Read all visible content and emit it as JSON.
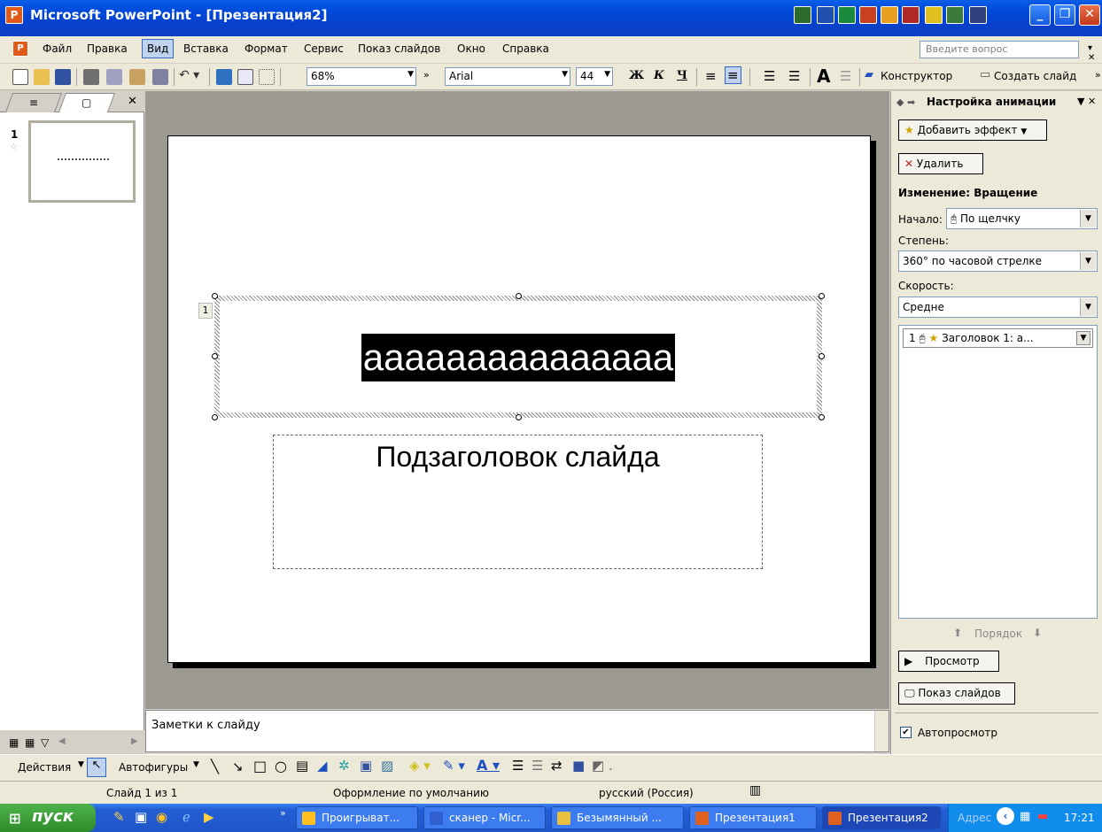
{
  "window": {
    "title": "Microsoft PowerPoint - [Презентация2]",
    "controls": {
      "minimize": "_",
      "restore": "❐",
      "close": "✕"
    }
  },
  "menu": {
    "items": [
      "Файл",
      "Правка",
      "Вид",
      "Вставка",
      "Формат",
      "Сервис",
      "Показ слайдов",
      "Окно",
      "Справка"
    ],
    "help_placeholder": "Введите вопрос"
  },
  "toolbar": {
    "zoom": "68%",
    "font": "Arial",
    "font_size": "44",
    "bold": "Ж",
    "italic": "К",
    "underline": "Ч",
    "designer": "Конструктор",
    "new_slide": "Создать слайд"
  },
  "left_pane": {
    "slide_number": "1",
    "tab_outline_icon": "outline-icon",
    "tab_slides_icon": "slides-icon"
  },
  "slide": {
    "title": "ааааааааааааааа",
    "subtitle": "Подзаголовок слайда",
    "anim_tag": "1"
  },
  "notes": {
    "placeholder": "Заметки к слайду"
  },
  "animation_pane": {
    "header": "Настройка анимации",
    "add_effect": "Добавить эффект",
    "remove": "Удалить",
    "change_label": "Изменение: Вращение",
    "start_label": "Начало:",
    "start_value": "По щелчку",
    "degree_label": "Степень:",
    "degree_value": "360° по часовой стрелке",
    "speed_label": "Скорость:",
    "speed_value": "Средне",
    "list_item_num": "1",
    "list_item": "Заголовок 1: а...",
    "order": "Порядок",
    "preview": "Просмотр",
    "slideshow": "Показ слайдов",
    "autopreview": "Автопросмотр",
    "autopreview_checked": true
  },
  "draw_toolbar": {
    "actions": "Действия",
    "autoshapes": "Автофигуры"
  },
  "status": {
    "slide": "Слайд 1 из 1",
    "design": "Оформление по умолчанию",
    "language": "русский (Россия)"
  },
  "taskbar": {
    "start": "пуск",
    "tasks": [
      "Проигрыват...",
      "сканер - Micr...",
      "Безымянный ...",
      "Презентация1",
      "Презентация2"
    ],
    "address": "Адрес",
    "clock": "17:21"
  },
  "colors": {
    "titlebar": "#0a5ee8",
    "taskbar": "#245fd6",
    "start_button": "#3a9e36",
    "slide_bg": "#ffffff",
    "workspace": "#9c9a90"
  }
}
